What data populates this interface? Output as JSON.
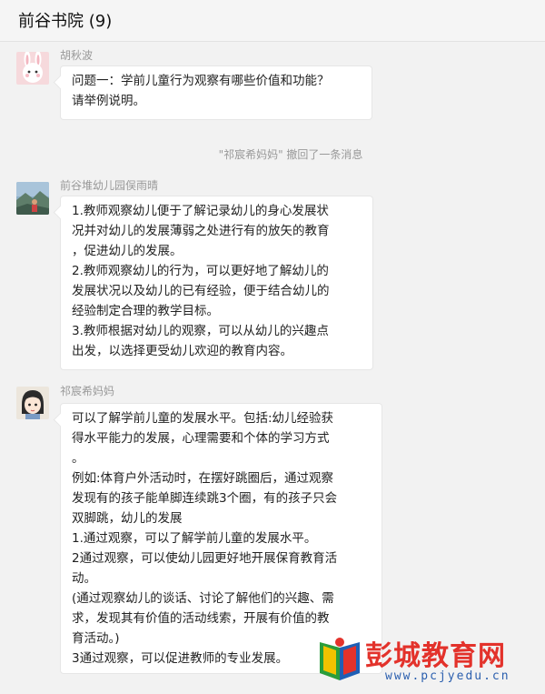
{
  "header": {
    "title": "前谷书院 (9)"
  },
  "messages": [
    {
      "sender": "胡秋波",
      "avatar_icon": "bunny-avatar-icon",
      "lines": [
        "问题一：学前儿童行为观察有哪些价值和功能？",
        "请举例说明。"
      ]
    },
    {
      "sender": "前谷堆幼儿园俣雨晴",
      "avatar_icon": "landscape-avatar-icon",
      "lines": [
        "1.教师观察幼儿便于了解记录幼儿的身心发展状",
        "况并对幼儿的发展薄弱之处进行有的放矢的教育",
        "，促进幼儿的发展。",
        "2.教师观察幼儿的行为，可以更好地了解幼儿的",
        "发展状况以及幼儿的已有经验，便于结合幼儿的",
        "经验制定合理的教学目标。",
        "3.教师根据对幼儿的观察，可以从幼儿的兴趣点",
        "出发，以选择更受幼儿欢迎的教育内容。"
      ]
    },
    {
      "sender": "祁宸希妈妈",
      "avatar_icon": "cartoon-girl-avatar-icon",
      "lines": [
        "可以了解学前儿童的发展水平。包括:幼儿经验获",
        "得水平能力的发展，心理需要和个体的学习方式",
        "。",
        "例如:体育户外活动时，在摆好跳圈后，通过观察",
        "发现有的孩子能单脚连续跳3个圈，有的孩子只会",
        "双脚跳，幼儿的发展",
        "1.通过观察，可以了解学前儿童的发展水平。",
        "2通过观察，可以使幼儿园更好地开展保育教育活",
        "动。",
        "(通过观察幼儿的谈话、讨论了解他们的兴趣、需",
        "求，发现其有价值的活动线索，开展有价值的教",
        "育活动。)",
        "3通过观察，可以促进教师的专业发展。"
      ]
    }
  ],
  "system_notice": "\"祁宸希妈妈\" 撤回了一条消息",
  "watermark": {
    "text": "彭城教育网",
    "url": "www.pcjyedu.cn",
    "logo_icon": "book-logo-icon"
  },
  "colors": {
    "background": "#f2f2f2",
    "bubble": "#ffffff",
    "watermark_red": "#e3322b",
    "watermark_blue": "#2b5fae"
  }
}
